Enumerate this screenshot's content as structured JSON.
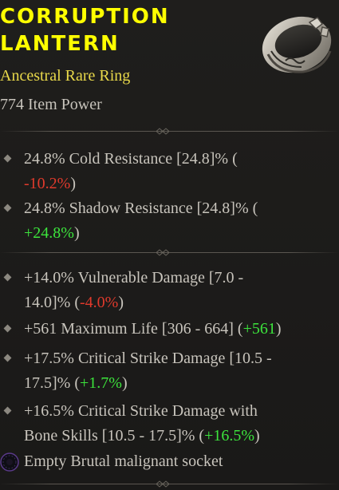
{
  "item": {
    "name": "Corruption\nLantern",
    "type": "Ancestral Rare Ring",
    "item_power": "774 Item Power"
  },
  "implicit_affixes": [
    {
      "line1_before": "24.8% Cold Resistance [24.8]% (",
      "line2_delta": "-10.2%",
      "line2_after": ")",
      "delta_sign": "negative"
    },
    {
      "line1_before": "24.8% Shadow Resistance [24.8]% (",
      "line2_delta": "+24.8%",
      "line2_after": ")",
      "delta_sign": "positive"
    }
  ],
  "affixes": [
    {
      "line1": "+14.0% Vulnerable Damage [7.0 -",
      "line2_before": "14.0]% (",
      "delta": "-4.0%",
      "line2_after": ")",
      "delta_sign": "negative"
    },
    {
      "line1_before": "+561 Maximum Life [306 - 664] (",
      "delta": "+561",
      "line1_after": ")",
      "delta_sign": "positive"
    },
    {
      "line1": "+17.5% Critical Strike Damage [10.5 -",
      "line2_before": "17.5]% (",
      "delta": "+1.7%",
      "line2_after": ")",
      "delta_sign": "positive"
    },
    {
      "line1": "+16.5% Critical Strike Damage with",
      "line2_before": "Bone Skills [10.5 - 17.5]% (",
      "delta": "+16.5%",
      "line2_after": ")",
      "delta_sign": "positive"
    }
  ],
  "socket": {
    "label": "Empty Brutal malignant socket",
    "icon": "malignant-socket-icon"
  },
  "colors": {
    "title": "#ffff00",
    "rare_type": "#e8d84a",
    "text": "#c8c4bc",
    "negative": "#e03a2c",
    "positive": "#3ce43c",
    "background": "#1c1b1a"
  }
}
